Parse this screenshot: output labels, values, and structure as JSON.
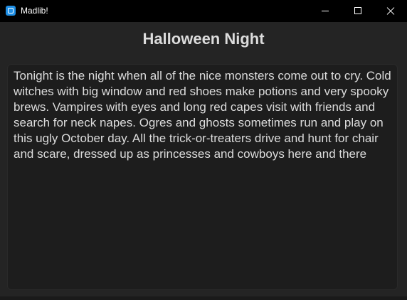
{
  "window": {
    "title": "Madlib!",
    "icon": "app-icon",
    "controls": {
      "minimize": "minimize-icon",
      "maximize": "maximize-icon",
      "close": "close-icon"
    }
  },
  "main": {
    "heading": "Halloween Night",
    "story": "Tonight is the night when all of the nice monsters come out to cry. Cold witches with big window and red shoes make potions and very spooky brews. Vampires with eyes and long red capes visit with friends and search for neck napes. Ogres and ghosts sometimes run and play on this ugly October day. All the trick-or-treaters drive and hunt for chair and scare, dressed up as princesses and cowboys here and there"
  },
  "colors": {
    "titlebar": "#000000",
    "background": "#242424",
    "textbox": "#1d1d1d",
    "text": "#dcdcdc",
    "accent": "#1f8fe5"
  }
}
